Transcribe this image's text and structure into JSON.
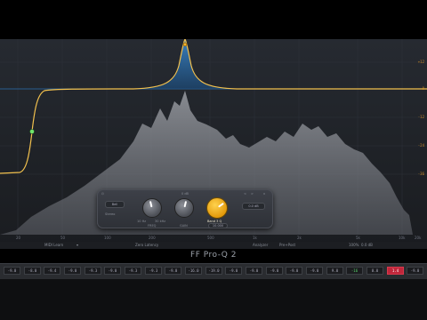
{
  "plugin": {
    "title": "FF Pro-Q 2",
    "db_scale": [
      "+12",
      "0",
      "-12",
      "-24",
      "-36"
    ],
    "freq_ticks": [
      "20",
      "50",
      "100",
      "200",
      "500",
      "1k",
      "2k",
      "5k",
      "10k",
      "20k"
    ]
  },
  "band_panel": {
    "bypass_label": "Bell",
    "stereo_label": "Stereo",
    "top_value": "0 dB",
    "freq_label": "FREQ",
    "freq_min": "10 Hz",
    "freq_max": "30 kHz",
    "gain_label": "GAIN",
    "q_label": "Band 3 Q",
    "q_value": "10.000",
    "extra_label": "0.0 dB",
    "close_label": "x",
    "nav_labels": [
      "<",
      ">"
    ],
    "gain_level": 0.55,
    "q_level": 0.7,
    "freq_level": 0.45
  },
  "bottom_bar": {
    "midi_learn": "MIDI Learn",
    "latency": "Zero Latency",
    "analyzer": "Analyzer",
    "analyzer_mode": "Pre+Post",
    "zoom": "100%",
    "output": "0.0 dB"
  },
  "meters": {
    "values": [
      "-9.0",
      "-8.0",
      "-9.4",
      "-9.0",
      "-9.3",
      "-9.0",
      "-9.3",
      "-9.3",
      "-9.0",
      "-16.0",
      "-19.0",
      "-9.0",
      "-9.0",
      "-9.0",
      "-9.0",
      "-9.0",
      "9.0",
      "-16",
      "0.0",
      "1.4",
      "-9.0"
    ],
    "green_index": 17,
    "red_index": 19
  },
  "colors": {
    "curve": "#f2c14e",
    "band_fill": "#2f6fa8",
    "analyzer_fill": "#8a8d93",
    "accent": "#f3b12a"
  }
}
